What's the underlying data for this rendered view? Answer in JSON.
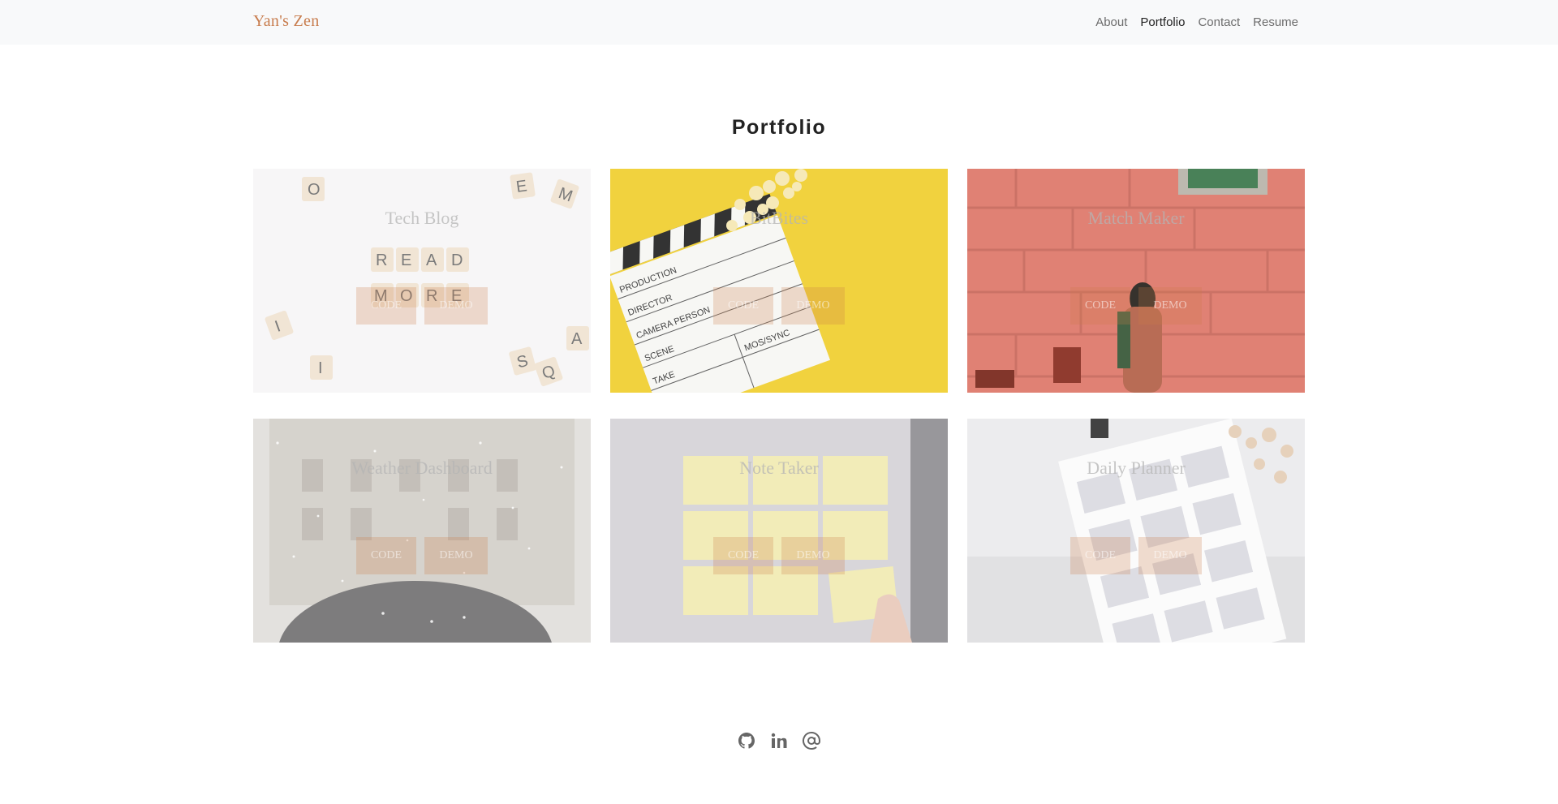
{
  "nav": {
    "brand": "Yan's Zen",
    "links": [
      {
        "label": "About",
        "active": false
      },
      {
        "label": "Portfolio",
        "active": true
      },
      {
        "label": "Contact",
        "active": false
      },
      {
        "label": "Resume",
        "active": false
      }
    ]
  },
  "main": {
    "title": "Portfolio",
    "projects": [
      {
        "title": "Tech Blog",
        "code_label": "CODE",
        "demo_label": "DEMO",
        "image": "scrabble-tiles-read-more"
      },
      {
        "title": "BitBites",
        "code_label": "CODE",
        "demo_label": "DEMO",
        "image": "film-clapperboard-popcorn"
      },
      {
        "title": "Match Maker",
        "code_label": "CODE",
        "demo_label": "DEMO",
        "image": "woman-red-brick-wall"
      },
      {
        "title": "Weather Dashboard",
        "code_label": "CODE",
        "demo_label": "DEMO",
        "image": "snowy-umbrella"
      },
      {
        "title": "Note Taker",
        "code_label": "CODE",
        "demo_label": "DEMO",
        "image": "sticky-notes-wall"
      },
      {
        "title": "Daily Planner",
        "code_label": "CODE",
        "demo_label": "DEMO",
        "image": "calendar-planner"
      }
    ]
  },
  "footer": {
    "icons": [
      "github-icon",
      "linkedin-icon",
      "email-at-icon"
    ]
  },
  "colors": {
    "brand": "#c87d4e",
    "navbar_bg": "#f8f9fa",
    "button_tint": "#cd7d46"
  }
}
